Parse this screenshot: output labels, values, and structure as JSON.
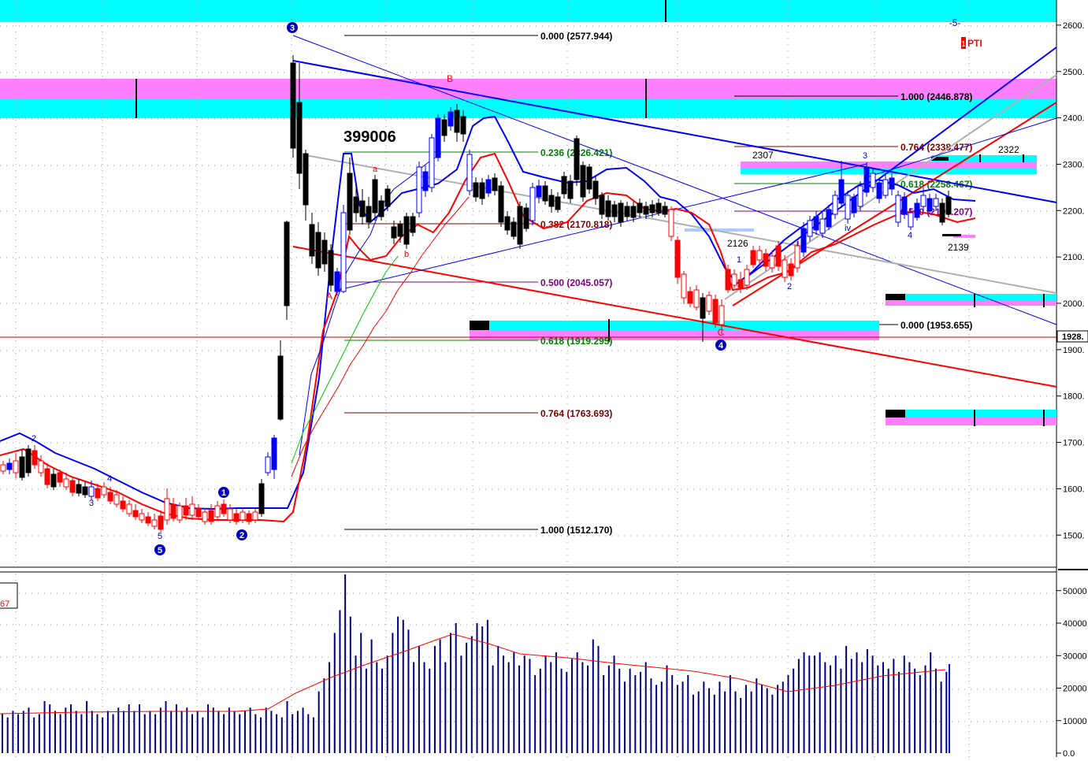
{
  "chart_data": {
    "type": "candlestick",
    "annotation_id": "399006",
    "indicator_tag": "PTI",
    "indicator_tag_prefix": "1",
    "top_marker": "-5-",
    "current_price_label": "1928.",
    "volume_left_label": "67",
    "price_axis": {
      "ticks": [
        "2600.",
        "2500.",
        "2400.",
        "2300.",
        "2200.",
        "2100.",
        "2000.",
        "1900.",
        "1800.",
        "1700.",
        "1600.",
        "1500."
      ],
      "values": [
        2600,
        2500,
        2400,
        2300,
        2200,
        2100,
        2000,
        1900,
        1800,
        1700,
        1600,
        1500
      ],
      "range": [
        1430,
        2660
      ]
    },
    "volume_axis": {
      "ticks": [
        "50000",
        "40000",
        "30000",
        "20000",
        "10000",
        "0.0"
      ],
      "values": [
        50000,
        40000,
        30000,
        20000,
        10000,
        0
      ],
      "range": [
        0,
        57000
      ]
    },
    "fib_retracement_main": [
      {
        "label": "0.000 (2577.944)",
        "ratio": 0.0,
        "price": 2577.944,
        "color": "#000000"
      },
      {
        "label": "0.236 (2326.421)",
        "ratio": 0.236,
        "price": 2326.421,
        "color": "#008000"
      },
      {
        "label": "0.382 (2170.818)",
        "ratio": 0.382,
        "price": 2170.818,
        "color": "#800000"
      },
      {
        "label": "0.500 (2045.057)",
        "ratio": 0.5,
        "price": 2045.057,
        "color": "#800080"
      },
      {
        "label": "0.618 (1919.295)",
        "ratio": 0.618,
        "price": 1919.295,
        "color": "#008000"
      },
      {
        "label": "0.764 (1763.693)",
        "ratio": 0.764,
        "price": 1763.693,
        "color": "#800000"
      },
      {
        "label": "1.000 (1512.170)",
        "ratio": 1.0,
        "price": 1512.17,
        "color": "#000000"
      }
    ],
    "fib_retracement_right": [
      {
        "label": "1.000 (2446.878)",
        "price": 2446.878,
        "color": "#000000"
      },
      {
        "label": "0.764 (2338.477)",
        "price": 2338.477,
        "color": "#800000"
      },
      {
        "label": "0.618 (2258.467)",
        "price": 2258.467,
        "color": "#008000"
      },
      {
        "label": "0.500 (2199.207)",
        "price": 2199.207,
        "color": "#800080"
      },
      {
        "label": "0.000 (1953.655)",
        "price": 1953.655,
        "color": "#000000"
      }
    ],
    "price_labels": [
      {
        "text": "2307",
        "price": 2307
      },
      {
        "text": "2126",
        "price": 2126
      },
      {
        "text": "2322",
        "price": 2322
      },
      {
        "text": "2139",
        "price": 2139
      }
    ],
    "wave_labels_circled": [
      "3",
      "1",
      "2",
      "4",
      "5"
    ],
    "wave_labels_text": [
      "B",
      "A",
      "C",
      "a",
      "b",
      "1",
      "2",
      "3",
      "4",
      "5",
      "i",
      "ii",
      "iii",
      "iv"
    ],
    "colors": {
      "up": "#0000ff",
      "down": "#000000",
      "weak": "#ff0000",
      "ma_red": "#ff0000",
      "ma_blue": "#0000ff",
      "cyan": "#00ffff",
      "magenta": "#ff80ff",
      "gridline": "#9a9a9a"
    }
  }
}
